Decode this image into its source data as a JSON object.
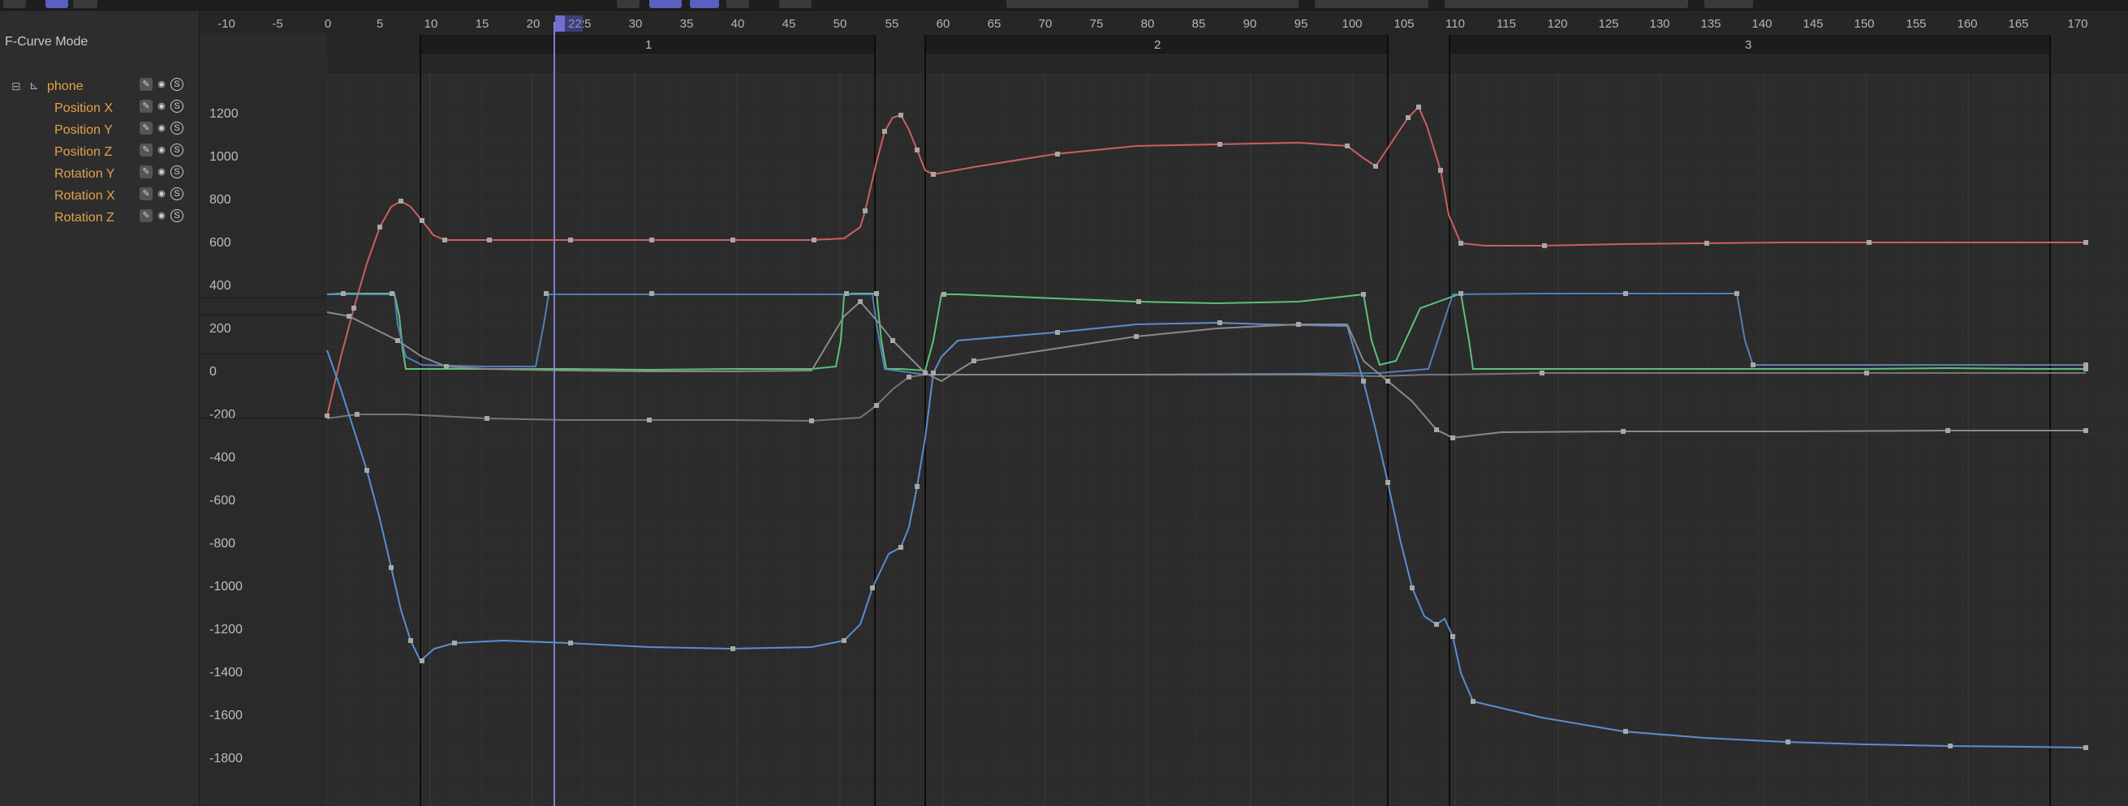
{
  "mode_label": "F-Curve Mode",
  "tracks": {
    "object": "phone",
    "items": [
      {
        "label": "Position X"
      },
      {
        "label": "Position Y"
      },
      {
        "label": "Position Z"
      },
      {
        "label": "Rotation Y"
      },
      {
        "label": "Rotation X"
      },
      {
        "label": "Rotation Z"
      }
    ]
  },
  "ruler": {
    "frames": [
      "-10",
      "-5",
      "0",
      "5",
      "10",
      "15",
      "20",
      "25",
      "30",
      "35",
      "40",
      "45",
      "50",
      "55",
      "60",
      "65",
      "70",
      "75",
      "80",
      "85",
      "90",
      "95",
      "100",
      "105",
      "110",
      "115",
      "120",
      "125",
      "130",
      "135",
      "140",
      "145",
      "150",
      "155",
      "160",
      "165",
      "170"
    ],
    "current_frame": "22"
  },
  "takes": [
    "1",
    "2",
    "3"
  ],
  "value_axis": [
    "1200",
    "1000",
    "800",
    "600",
    "400",
    "200",
    "0",
    "-200",
    "-400",
    "-600",
    "-800",
    "-1000",
    "-1200",
    "-1400",
    "-1600",
    "-1800"
  ],
  "colors": {
    "position_x": "#cf5e5e",
    "position_y": "#5a8ecf",
    "position_z": "#5fc07a",
    "playhead": "#7f7fd4",
    "key": "#a8a8a8"
  }
}
